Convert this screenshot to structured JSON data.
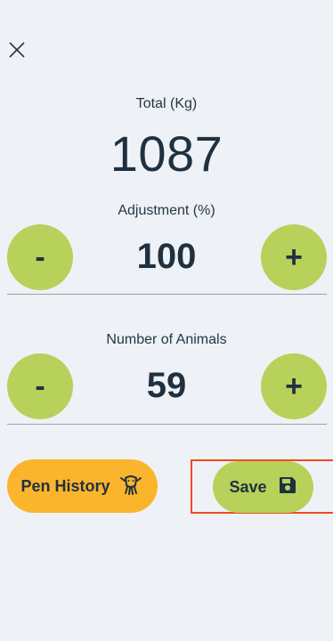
{
  "header": {
    "close_icon": "close-icon"
  },
  "total": {
    "label": "Total (Kg)",
    "value": "1087"
  },
  "adjustment": {
    "label": "Adjustment (%)",
    "value": "100",
    "minus_label": "-",
    "plus_label": "+"
  },
  "animals": {
    "label": "Number of Animals",
    "value": "59",
    "minus_label": "-",
    "plus_label": "+"
  },
  "actions": {
    "pen_history_label": "Pen History",
    "pen_history_icon": "cattle-icon",
    "save_label": "Save",
    "save_icon": "floppy-disk-icon"
  },
  "colors": {
    "background": "#eef1f5",
    "accent_green": "#b7d15a",
    "accent_orange": "#fbb52c",
    "highlight_red": "#f04b1f",
    "text_dark": "#1f3140"
  }
}
